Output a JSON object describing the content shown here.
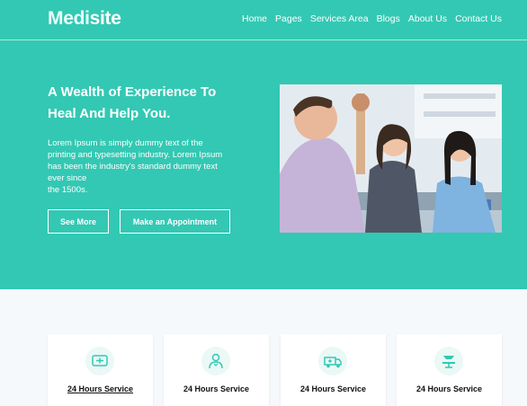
{
  "brand": {
    "part1": "Medi",
    "part2": "site"
  },
  "nav": {
    "items": [
      "Home",
      "Pages",
      "Services Area",
      "Blogs",
      "About Us",
      "Contact Us"
    ]
  },
  "hero": {
    "headline_line1": "A Wealth of Experience To",
    "headline_line2": "Heal And Help You.",
    "paragraph_lines": [
      "Lorem Ipsum is simply dummy text of the",
      "printing and typesetting industry. Lorem Ipsum",
      "has been the industry's standard dummy text",
      "ever since",
      "the 1500s."
    ],
    "buttons": {
      "see_more": "See More",
      "appointment": "Make an Appointment"
    }
  },
  "services": {
    "cards": [
      {
        "title": "24 Hours Service",
        "icon": "monitor-heart-icon"
      },
      {
        "title": "24 Hours Service",
        "icon": "doctor-icon"
      },
      {
        "title": "24 Hours Service",
        "icon": "ambulance-icon"
      },
      {
        "title": "24 Hours Service",
        "icon": "operating-bed-icon"
      }
    ]
  },
  "colors": {
    "primary": "#33c8b3",
    "background": "#f6f9fc"
  }
}
